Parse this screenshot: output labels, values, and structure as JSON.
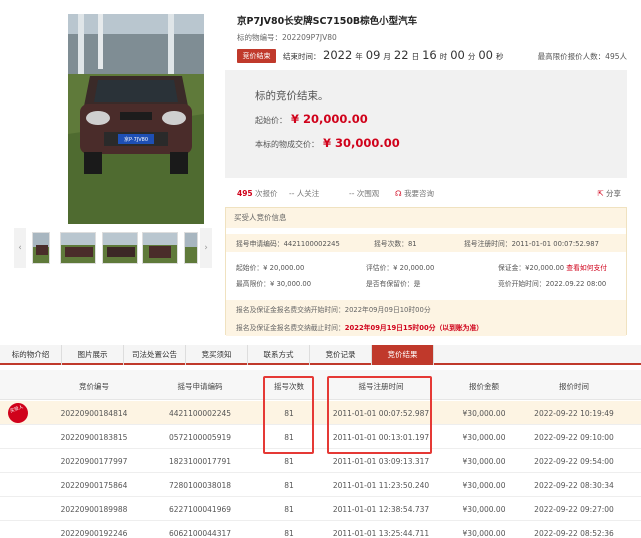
{
  "item": {
    "title": "京P7JV80长安牌SC7150B棕色小型汽车",
    "lot_label": "标的物编号：",
    "lot_no": "202209P7JV80",
    "plate": "京P·7JV80"
  },
  "status": {
    "badge": "竞价结束",
    "end_label": "结束时间：",
    "year": "2022",
    "year_u": "年",
    "month": "09",
    "month_u": "月",
    "day": "22",
    "day_u": "日",
    "hour": "16",
    "hour_u": "时",
    "minute": "00",
    "minute_u": "分",
    "second": "00",
    "second_u": "秒",
    "max_bidders": "最高限价报价人数：495人"
  },
  "result": {
    "title": "标的竞价结束。",
    "start_label": "起始价：",
    "start_price": "¥ 20,000.00",
    "deal_label": "本标的物成交价：",
    "deal_price": "¥ 30,000.00"
  },
  "stats": {
    "bids_num": "495",
    "bids_label": "次报价",
    "follow": "-- 人关注",
    "views": "-- 次围观",
    "consult": "我要咨询",
    "share": "分享"
  },
  "bidder": {
    "header": "买受人竞价信息",
    "code_label": "摇号申请编码：",
    "code": "4421100002245",
    "count_label": "摇号次数：",
    "count": "81",
    "reg_label": "摇号注册时间：",
    "reg": "2011-01-01 00:07:52.987",
    "start": "起始价：¥ 20,000.00",
    "eval": "评估价：¥ 20,000.00",
    "deposit_label": "保证金：¥20,000.00",
    "deposit_link": "查看如何支付",
    "cap": "最高限价：¥ 30,000.00",
    "priority": "是否有保留价：是",
    "bid_start": "竞价开始时间：2022.09.22 08:00",
    "apply_start": "报名及保证金报名费交纳开始时间：2022年09月09日10时00分",
    "apply_end_label": "报名及保证金报名费交纳截止时间：",
    "apply_end": "2022年09月19日15时00分（以到账为准）"
  },
  "tabs": [
    {
      "label": "标的物介绍"
    },
    {
      "label": "图片展示"
    },
    {
      "label": "司法处置公告"
    },
    {
      "label": "竞买须知"
    },
    {
      "label": "联系方式"
    },
    {
      "label": "竞价记录"
    },
    {
      "label": "竞价结果"
    }
  ],
  "table": {
    "headers": [
      "竞价编号",
      "摇号申请编码",
      "摇号次数",
      "摇号注册时间",
      "报价金额",
      "报价时间"
    ],
    "winner_tag": "买受人",
    "rows": [
      [
        "20220900184814",
        "4421100002245",
        "81",
        "2011-01-01 00:07:52.987",
        "¥30,000.00",
        "2022-09-22 10:19:49"
      ],
      [
        "20220900183815",
        "0572100005919",
        "81",
        "2011-01-01 00:13:01.197",
        "¥30,000.00",
        "2022-09-22 09:10:00"
      ],
      [
        "20220900177997",
        "1823100017791",
        "81",
        "2011-01-01 03:09:13.317",
        "¥30,000.00",
        "2022-09-22 09:54:00"
      ],
      [
        "20220900175864",
        "7280100038018",
        "81",
        "2011-01-01 11:23:50.240",
        "¥30,000.00",
        "2022-09-22 08:30:34"
      ],
      [
        "20220900189988",
        "6227100041969",
        "81",
        "2011-01-01 12:38:54.737",
        "¥30,000.00",
        "2022-09-22 09:27:00"
      ],
      [
        "20220900192246",
        "6062100044317",
        "81",
        "2011-01-01 13:25:44.711",
        "¥30,000.00",
        "2022-09-22 08:52:36"
      ]
    ]
  }
}
